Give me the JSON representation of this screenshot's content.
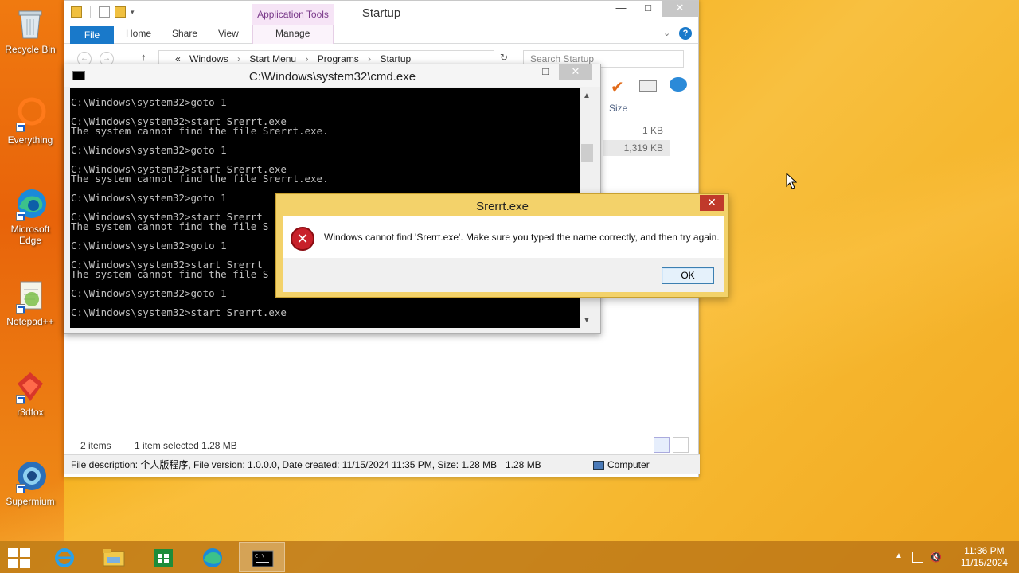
{
  "desktop": {
    "icons": [
      {
        "label": "Recycle Bin",
        "icon": "recycle-bin-icon"
      },
      {
        "label": "Everything",
        "icon": "everything-icon"
      },
      {
        "label": "Microsoft Edge",
        "icon": "edge-icon"
      },
      {
        "label": "Notepad++",
        "icon": "notepadpp-icon"
      },
      {
        "label": "r3dfox",
        "icon": "r3dfox-icon"
      },
      {
        "label": "Supermium",
        "icon": "supermium-icon"
      }
    ]
  },
  "explorer": {
    "title": "Startup",
    "contextual_tab": "Application Tools",
    "tabs": {
      "file": "File",
      "home": "Home",
      "share": "Share",
      "view": "View",
      "manage": "Manage"
    },
    "breadcrumb": {
      "prefix": "«",
      "items": [
        "Windows",
        "Start Menu",
        "Programs",
        "Startup"
      ]
    },
    "search_placeholder": "Search Startup",
    "column_size": "Size",
    "sizes": [
      "1 KB",
      "1,319 KB"
    ],
    "status": {
      "items": "2 items",
      "selected": "1 item selected  1.28 MB"
    },
    "details": {
      "description": "File description: 个人版程序, File version: 1.0.0.0, Date created: 11/15/2024 11:35 PM, Size: 1.28 MB",
      "size": "1.28 MB",
      "location": "Computer"
    },
    "window_buttons": {
      "minimize": "—",
      "maximize": "□",
      "close": "✕"
    }
  },
  "cmd": {
    "title": "C:\\Windows\\system32\\cmd.exe",
    "lines": [
      "C:\\Windows\\system32>goto 1",
      "",
      "C:\\Windows\\system32>start Srerrt.exe",
      "The system cannot find the file Srerrt.exe.",
      "",
      "C:\\Windows\\system32>goto 1",
      "",
      "C:\\Windows\\system32>start Srerrt.exe",
      "The system cannot find the file Srerrt.exe.",
      "",
      "C:\\Windows\\system32>goto 1",
      "",
      "C:\\Windows\\system32>start Srerrt",
      "The system cannot find the file S",
      "",
      "C:\\Windows\\system32>goto 1",
      "",
      "C:\\Windows\\system32>start Srerrt",
      "The system cannot find the file S",
      "",
      "C:\\Windows\\system32>goto 1",
      "",
      "C:\\Windows\\system32>start Srerrt.exe"
    ],
    "window_buttons": {
      "minimize": "—",
      "maximize": "□",
      "close": "✕"
    }
  },
  "dialog": {
    "title": "Srerrt.exe",
    "message": "Windows cannot find 'Srerrt.exe'. Make sure you typed the name correctly, and then try again.",
    "ok_label": "OK",
    "close_label": "✕",
    "icon": "error-icon"
  },
  "taskbar": {
    "items": [
      "start-button",
      "internet-explorer",
      "file-explorer",
      "store",
      "edge",
      "cmd"
    ],
    "active": "cmd",
    "clock": {
      "time": "11:36 PM",
      "date": "11/15/2024"
    }
  },
  "colors": {
    "accent": "#1979ca",
    "error": "#c8202a",
    "dialog_frame": "#f3d26a"
  }
}
